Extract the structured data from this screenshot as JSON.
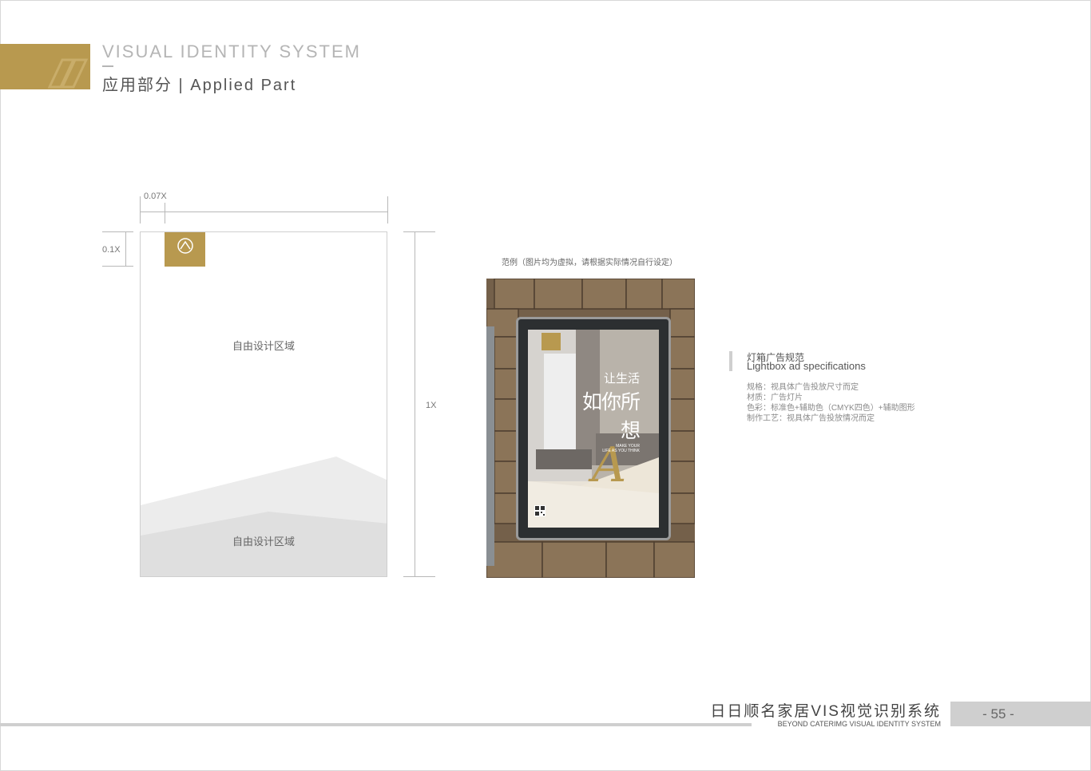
{
  "header": {
    "title": "VISUAL IDENTITY SYSTEM",
    "subtitle": "应用部分 | Applied Part"
  },
  "spec_drawing": {
    "dim_top": "0.07X",
    "dim_left": "0.1X",
    "dim_right": "1X",
    "zone_top": "自由设计区域",
    "zone_bottom": "自由设计区域"
  },
  "example": {
    "caption": "范例（图片均为虚拟，请根据实际情况自行设定）",
    "poster_headline_1": "让生活",
    "poster_headline_2": "如你所想",
    "poster_tagline_1": "MAKE YOUR",
    "poster_tagline_2": "LIFE AS YOU THINK"
  },
  "spec_text": {
    "title_cn": "灯箱广告规范",
    "title_en": "Lightbox ad specifications",
    "lines": [
      "规格：视具体广告投放尺寸而定",
      "材质：广告灯片",
      "色彩：标准色+辅助色（CMYK四色）+辅助图形",
      "制作工艺：视具体广告投放情况而定"
    ]
  },
  "footer": {
    "title": "日日顺名家居VIS视觉识别系统",
    "subtitle": "BEYOND CATERIMG VISUAL IDENTITY SYSTEM",
    "page_number": "- 55 -"
  },
  "colors": {
    "brand_gold": "#b8994f",
    "neutral_gray": "#cfcfcf"
  }
}
